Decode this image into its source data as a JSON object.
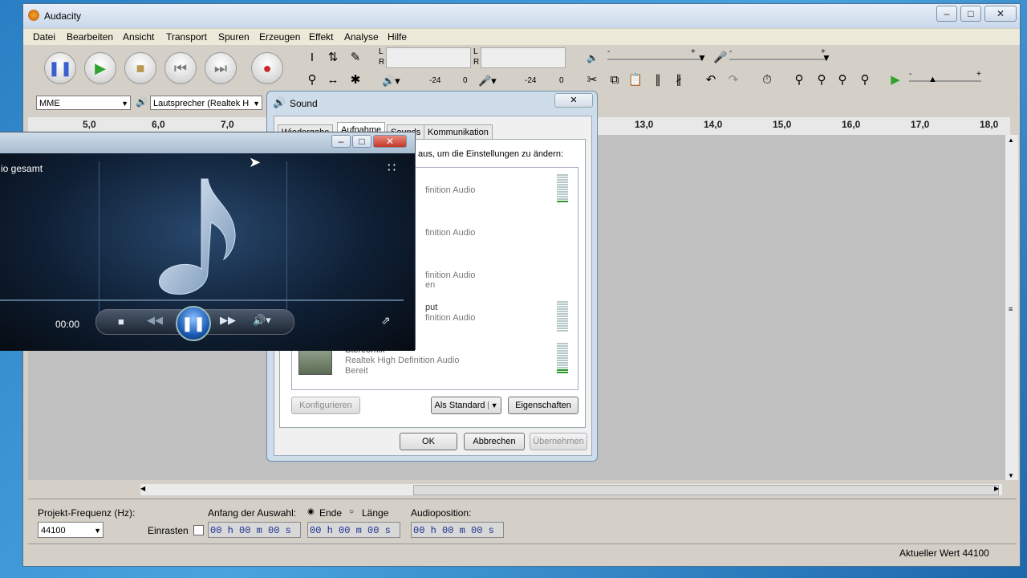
{
  "audacity": {
    "title": "Audacity",
    "menus": [
      "Datei",
      "Bearbeiten",
      "Ansicht",
      "Transport",
      "Spuren",
      "Erzeugen",
      "Effekt",
      "Analyse",
      "Hilfe"
    ],
    "meter": {
      "l": "L",
      "r": "R",
      "scale_a": "-24",
      "zero_a": "0",
      "scale_b": "-24",
      "zero_b": "0"
    },
    "slider_minus": "-",
    "slider_plus": "+",
    "host": "MME",
    "output_device": "Lautsprecher (Realtek H",
    "ruler": [
      "5,0",
      "6,0",
      "7,0",
      "13,0",
      "14,0",
      "15,0",
      "16,0",
      "17,0",
      "18,0"
    ],
    "selection": {
      "rate_label": "Projekt-Frequenz (Hz):",
      "rate_value": "44100",
      "snap_label": "Einrasten",
      "start_label": "Anfang der Auswahl:",
      "end_option": "Ende",
      "length_option": "Länge",
      "audio_pos_label": "Audioposition:",
      "time1": "00 h 00 m 00 s",
      "time2": "00 h 00 m 00 s",
      "time3": "00 h 00 m 00 s"
    },
    "status": "Aktueller Wert 44100"
  },
  "sound": {
    "title": "Sound",
    "tabs": [
      "Wiedergabe",
      "Aufnahme",
      "Sounds",
      "Kommunikation"
    ],
    "instruction": "aus, um die Einstellungen zu ändern:",
    "devices": [
      {
        "line1": "finition Audio"
      },
      {
        "line1": "finition Audio"
      },
      {
        "line1": "finition Audio",
        "line2": "en"
      },
      {
        "line0": "put",
        "line1": "finition Audio"
      },
      {
        "line0": "Stereomix",
        "line1": "Realtek High Definition Audio",
        "line2": "Bereit"
      }
    ],
    "configure": "Konfigurieren",
    "set_default": "Als Standard",
    "properties": "Eigenschaften",
    "ok": "OK",
    "cancel": "Abbrechen",
    "apply": "Übernehmen"
  },
  "wmp": {
    "info": "io gesamt",
    "time": "00:00"
  }
}
